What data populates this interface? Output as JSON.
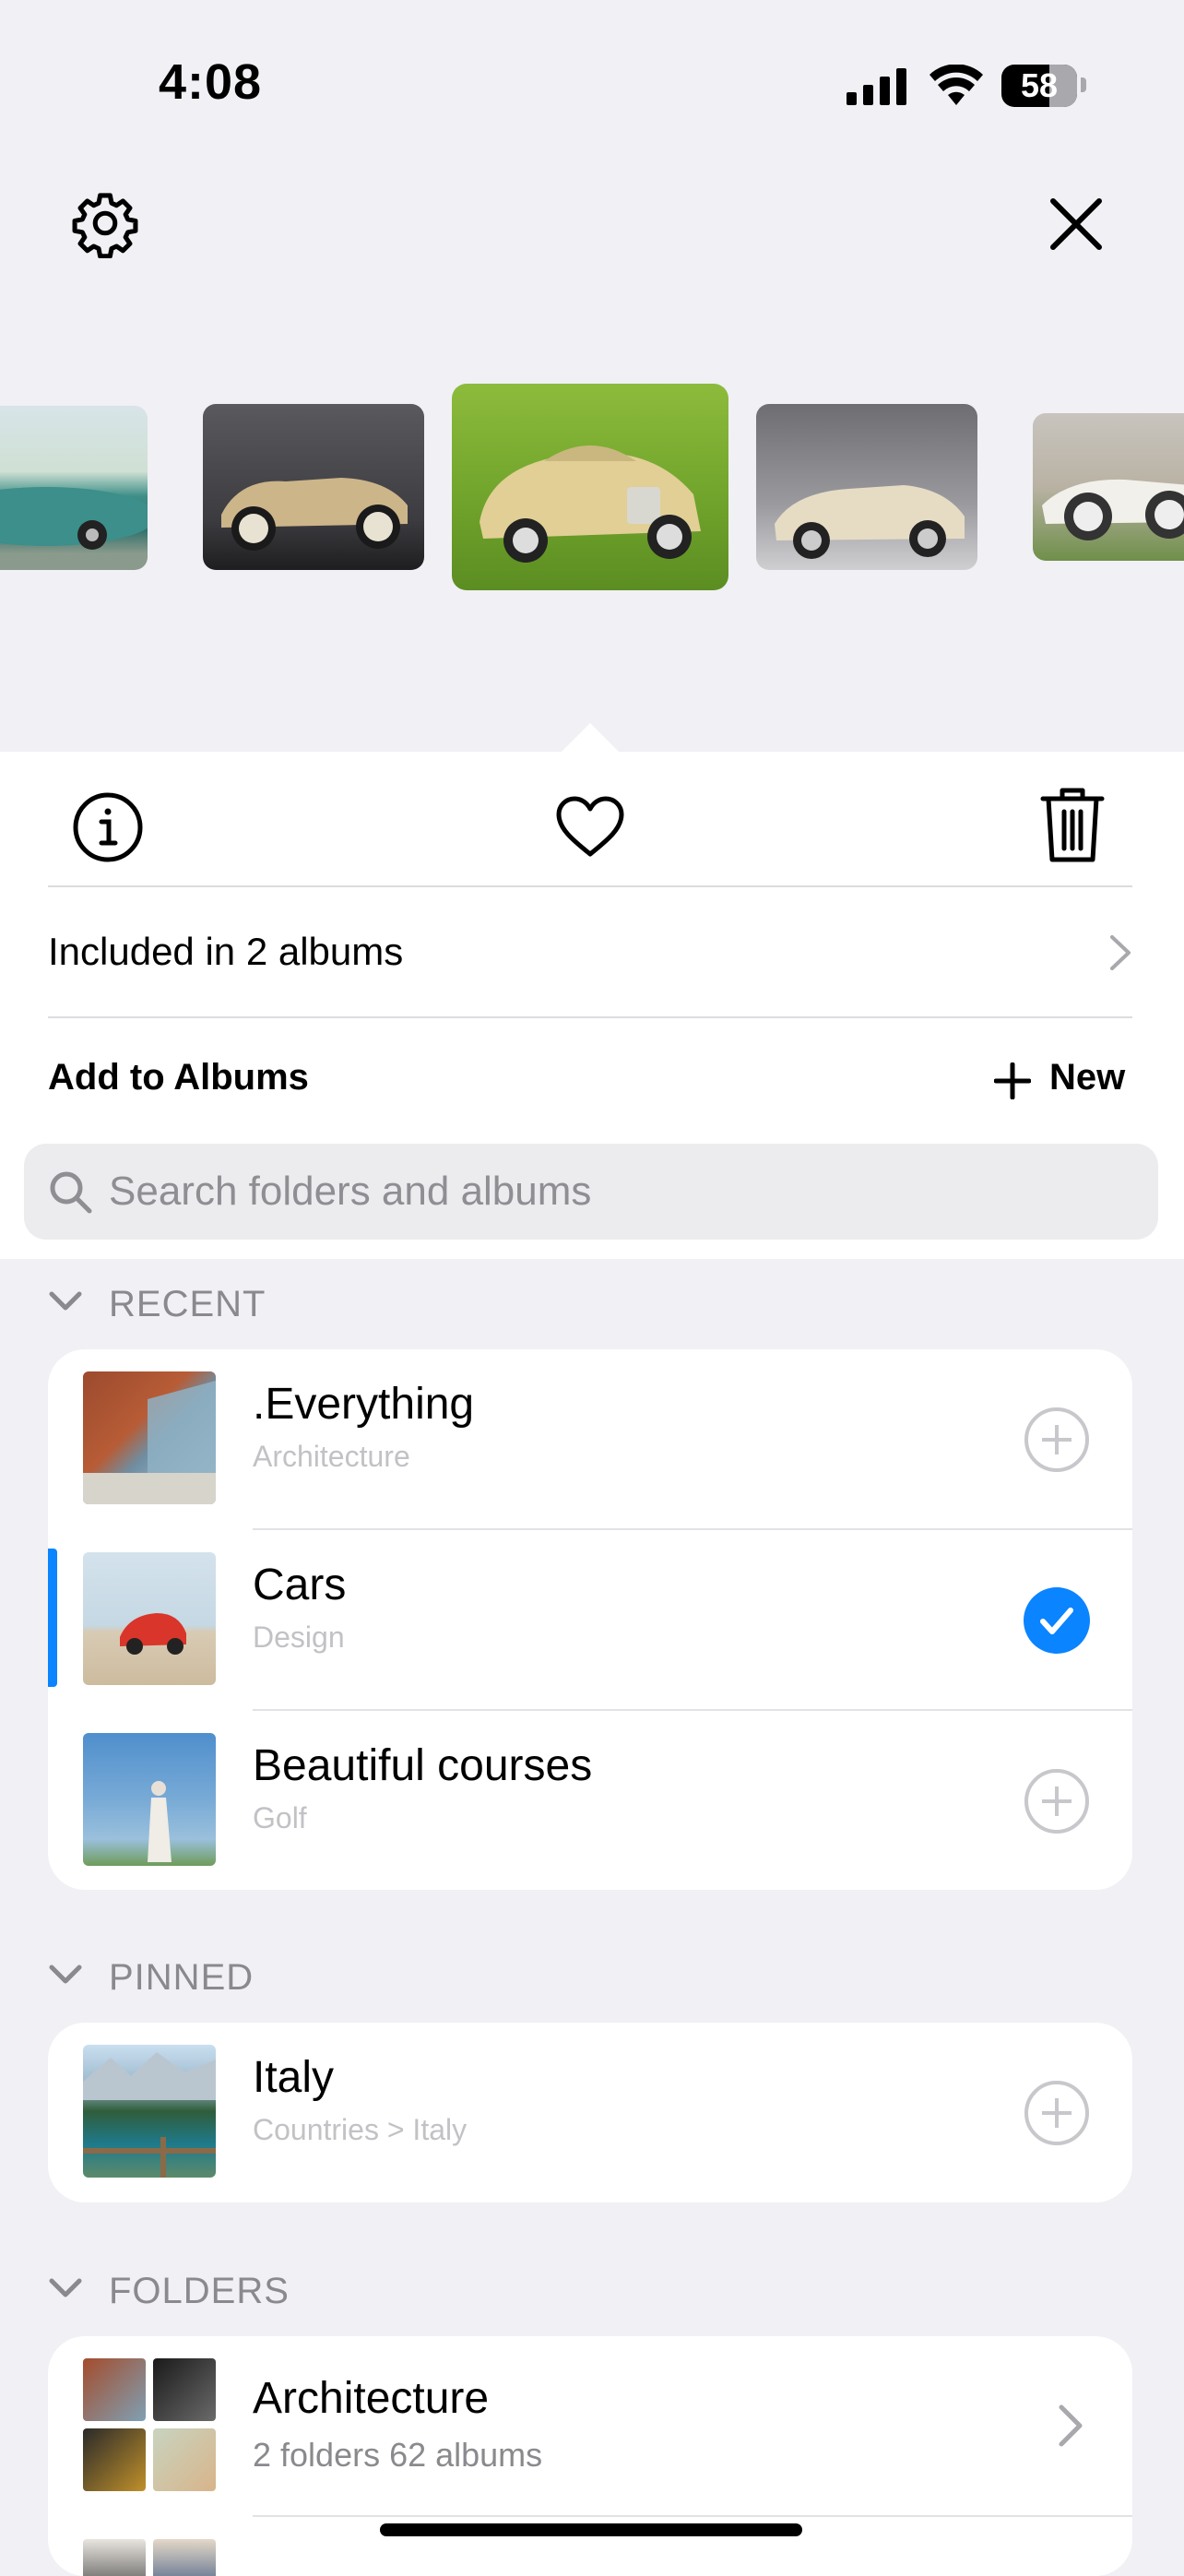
{
  "status_bar": {
    "time": "4:08",
    "battery": "58"
  },
  "toolbar": {
    "settings_icon": "gear-icon",
    "close_icon": "close-icon"
  },
  "carousel": {
    "selected_index": 2,
    "count": 5
  },
  "actions": {
    "info_icon": "info-icon",
    "favorite_icon": "heart-icon",
    "delete_icon": "trash-icon"
  },
  "included": {
    "label": "Included in 2 albums"
  },
  "add_to_albums": {
    "label": "Add to Albums",
    "new_label": "New"
  },
  "search": {
    "placeholder": "Search folders and albums"
  },
  "sections": {
    "recent": {
      "label": "RECENT",
      "items": [
        {
          "title": ".Everything",
          "subtitle": "Architecture",
          "selected": false
        },
        {
          "title": "Cars",
          "subtitle": "Design",
          "selected": true
        },
        {
          "title": "Beautiful courses",
          "subtitle": "Golf",
          "selected": false
        }
      ]
    },
    "pinned": {
      "label": "PINNED",
      "items": [
        {
          "title": "Italy",
          "subtitle": "Countries > Italy",
          "selected": false
        }
      ]
    },
    "folders": {
      "label": "FOLDERS",
      "items": [
        {
          "title": "Architecture",
          "subtitle": "2 folders 62 albums"
        }
      ]
    }
  },
  "colors": {
    "accent": "#0a84ff",
    "background": "#f0f0f5",
    "card": "#ffffff"
  }
}
